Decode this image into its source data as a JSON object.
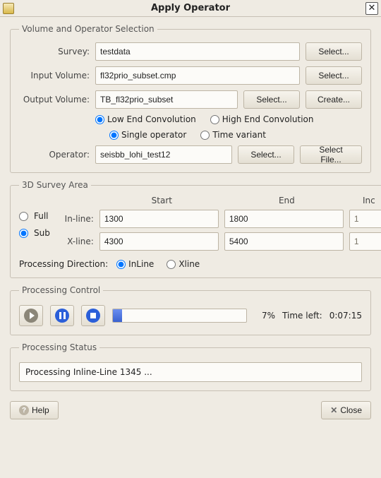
{
  "window": {
    "title": "Apply Operator",
    "close_glyph": "✕"
  },
  "volume_section": {
    "legend": "Volume and Operator Selection",
    "survey_label": "Survey:",
    "survey_value": "testdata",
    "survey_select": "Select...",
    "input_label": "Input Volume:",
    "input_value": "fl32prio_subset.cmp",
    "input_select": "Select...",
    "output_label": "Output Volume:",
    "output_value": "TB_fl32prio_subset",
    "output_select": "Select...",
    "output_create": "Create...",
    "conv_low": "Low End Convolution",
    "conv_high": "High End Convolution",
    "op_single": "Single operator",
    "op_timevar": "Time variant",
    "operator_label": "Operator:",
    "operator_value": "seisbb_lohi_test12",
    "operator_select": "Select...",
    "operator_file": "Select File..."
  },
  "survey3d": {
    "legend": "3D Survey Area",
    "full": "Full",
    "sub": "Sub",
    "start": "Start",
    "end": "End",
    "inc": "Inc",
    "inline_label": "In-line:",
    "inline_start": "1300",
    "inline_end": "1800",
    "inline_inc": "1",
    "xline_label": "X-line:",
    "xline_start": "4300",
    "xline_end": "5400",
    "xline_inc": "1",
    "procdir_label": "Processing Direction:",
    "procdir_inline": "InLine",
    "procdir_xline": "Xline"
  },
  "proc_control": {
    "legend": "Processing Control",
    "percent": "7%",
    "progress_width": "7%",
    "timeleft_label": "Time left:",
    "timeleft_value": "0:07:15"
  },
  "proc_status": {
    "legend": "Processing Status",
    "message": "Processing Inline-Line 1345 ..."
  },
  "footer": {
    "help": "Help",
    "close": "Close"
  }
}
